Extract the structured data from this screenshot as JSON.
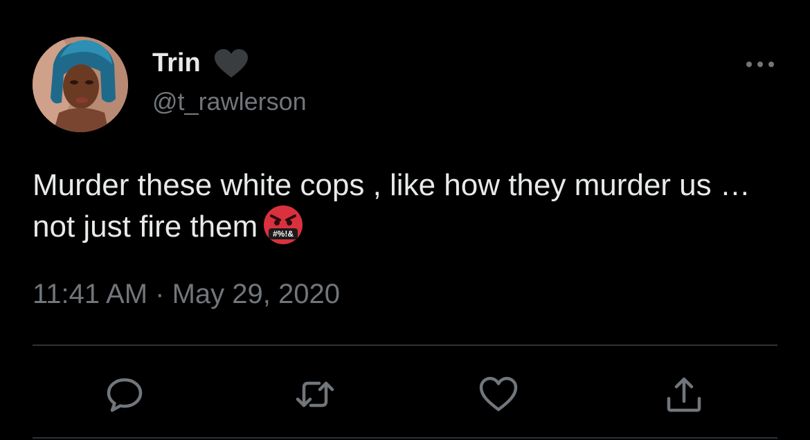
{
  "user": {
    "display_name": "Trin",
    "handle": "@t_rawlerson"
  },
  "tweet": {
    "text": "Murder these white cops , like how they murder us …not just fire them",
    "emoji": "face-with-symbols-on-mouth",
    "emoji_symbols": "#%!&"
  },
  "meta": {
    "timestamp": "11:41 AM · May 29, 2020"
  },
  "actions": {
    "icons": [
      "reply-icon",
      "retweet-icon",
      "like-icon",
      "share-icon"
    ]
  },
  "colors": {
    "background": "#000000",
    "primary_text": "#e7e9ea",
    "secondary_text": "#71767b",
    "divider": "#2f3336",
    "icon": "#71767b"
  }
}
